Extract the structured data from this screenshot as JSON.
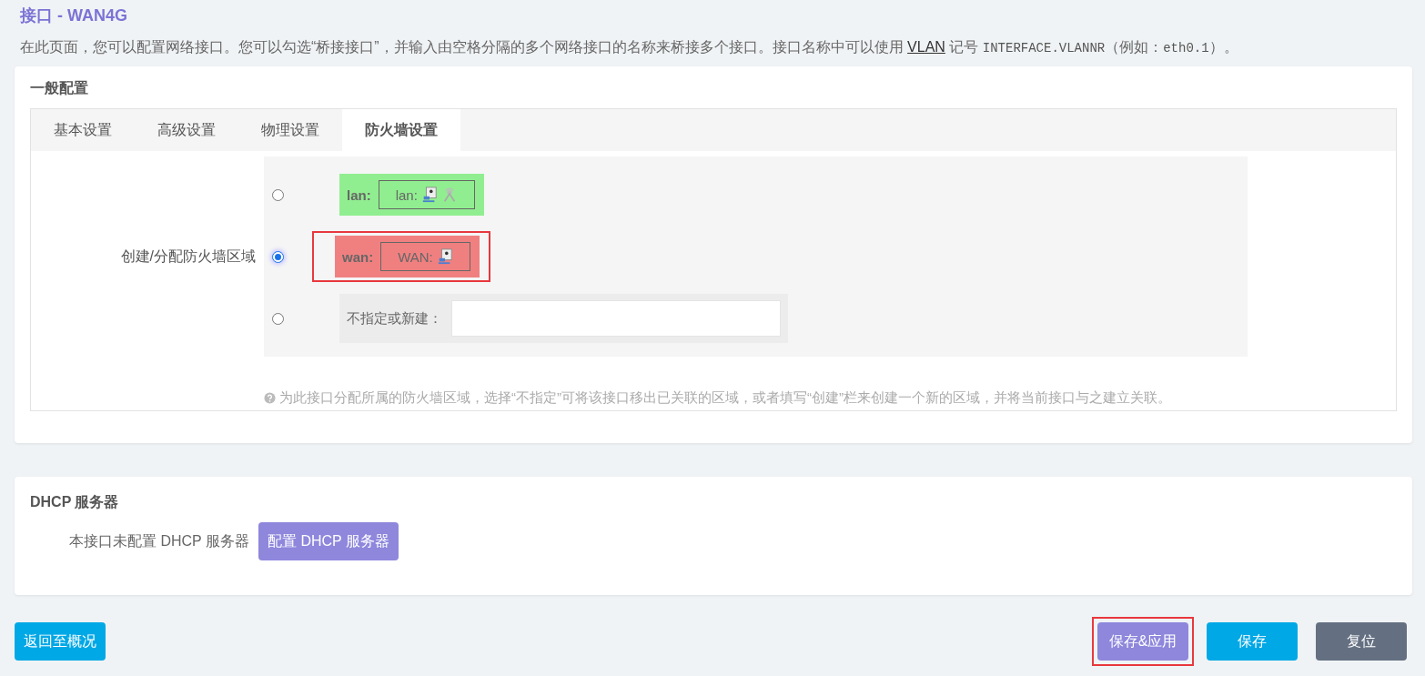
{
  "title": "接口 - WAN4G",
  "description": [
    {
      "kind": "text",
      "text": "在此页面，您可以配置网络接口。您可以勾选“桥接接口”，并输入由空格分隔的多个网络接口的名称来桥接多个接口。接口名称中可以使用 "
    },
    {
      "kind": "link",
      "text": "VLAN"
    },
    {
      "kind": "text",
      "text": " 记号 "
    },
    {
      "kind": "code",
      "text": "INTERFACE.VLANNR"
    },
    {
      "kind": "text",
      "text": "（例如："
    },
    {
      "kind": "code",
      "text": "eth0.1"
    },
    {
      "kind": "text",
      "text": "）。"
    }
  ],
  "general": {
    "title": "一般配置",
    "tabs": [
      {
        "label": "基本设置",
        "selected": false
      },
      {
        "label": "高级设置",
        "selected": false
      },
      {
        "label": "物理设置",
        "selected": false
      },
      {
        "label": "防火墙设置",
        "selected": true
      }
    ],
    "field_label": "创建/分配防火墙区域",
    "zones": [
      {
        "kind": "zone",
        "name": "lan:",
        "label": "lan:",
        "color": "#90ee90",
        "selected": false,
        "highlighted": false,
        "icons": [
          {
            "kind": "port"
          },
          {
            "kind": "inactive"
          }
        ]
      },
      {
        "kind": "zone",
        "name": "wan:",
        "label": "WAN:",
        "color": "#f08080",
        "selected": true,
        "highlighted": true,
        "icons": [
          {
            "kind": "port"
          }
        ]
      },
      {
        "kind": "new",
        "name": "不指定或新建：",
        "selected": false,
        "highlighted": false
      }
    ],
    "help": "为此接口分配所属的防火墙区域，选择“不指定”可将该接口移出已关联的区域，或者填写“创建”栏来创建一个新的区域，并将当前接口与之建立关联。"
  },
  "dhcp": {
    "title": "DHCP 服务器",
    "label": "本接口未配置 DHCP 服务器",
    "button": "配置 DHCP 服务器"
  },
  "back_button": "返回至概况",
  "actions": [
    {
      "kind": "apply",
      "label": "保存&应用",
      "highlighted": true
    },
    {
      "kind": "save",
      "label": "保存",
      "highlighted": false
    },
    {
      "kind": "reset",
      "label": "复位",
      "highlighted": false
    }
  ]
}
